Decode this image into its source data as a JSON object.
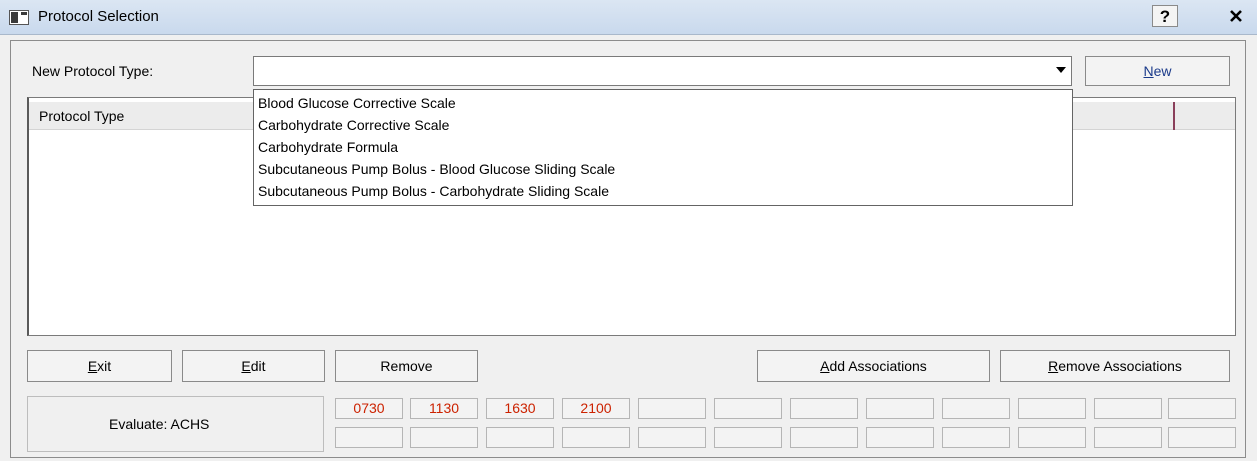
{
  "window": {
    "title": "Protocol Selection",
    "help_label": "?",
    "close_label": "✕"
  },
  "form": {
    "new_protocol_label": "New Protocol Type:",
    "combo_value": "",
    "new_button": "New"
  },
  "list": {
    "column_header": "Protocol Type"
  },
  "dropdown": {
    "items": [
      "Blood Glucose Corrective Scale",
      "Carbohydrate Corrective Scale",
      "Carbohydrate Formula",
      "Subcutaneous Pump Bolus - Blood Glucose Sliding Scale",
      "Subcutaneous Pump Bolus - Carbohydrate Sliding Scale"
    ]
  },
  "buttons": {
    "exit": "Exit",
    "edit": "Edit",
    "remove": "Remove",
    "add_associations": "Add Associations",
    "remove_associations": "Remove Associations"
  },
  "evaluate": {
    "label": "Evaluate:  ACHS",
    "times": [
      "0730",
      "1130",
      "1630",
      "2100",
      "",
      "",
      "",
      "",
      "",
      "",
      "",
      ""
    ],
    "times_row2": [
      "",
      "",
      "",
      "",
      "",
      "",
      "",
      "",
      "",
      "",
      "",
      ""
    ],
    "time_color": "#cc2200"
  },
  "icons": {
    "window_icon": "app-window-icon",
    "combo_arrow": "chevron-down-icon"
  }
}
